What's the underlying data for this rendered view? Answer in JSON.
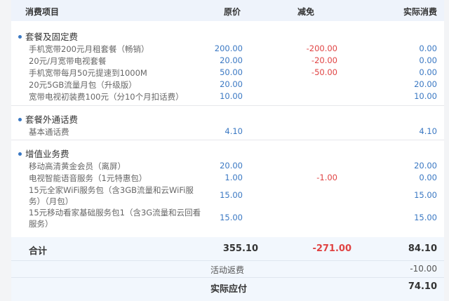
{
  "header": {
    "col_item": "消费项目",
    "col_original": "原价",
    "col_discount": "减免",
    "col_actual": "实际消费"
  },
  "sections": [
    {
      "title": "套餐及固定费",
      "rows": [
        {
          "name": "手机宽带200元月租套餐（畅销）",
          "original": "200.00",
          "discount": "-200.00",
          "actual": "0.00"
        },
        {
          "name": "20元/月宽带电视套餐",
          "original": "20.00",
          "discount": "-20.00",
          "actual": "0.00"
        },
        {
          "name": "手机宽带每月50元提速到1000M",
          "original": "50.00",
          "discount": "-50.00",
          "actual": "0.00"
        },
        {
          "name": "20元5GB流量月包（升级版）",
          "original": "20.00",
          "discount": "",
          "actual": "20.00"
        },
        {
          "name": "宽带电视初装费100元（分10个月扣话费）",
          "original": "10.00",
          "discount": "",
          "actual": "10.00"
        }
      ]
    },
    {
      "title": "套餐外通话费",
      "rows": [
        {
          "name": "基本通话费",
          "original": "4.10",
          "discount": "",
          "actual": "4.10"
        }
      ]
    },
    {
      "title": "增值业务费",
      "rows": [
        {
          "name": "移动高清黄金会员（离屏）",
          "original": "20.00",
          "discount": "",
          "actual": "20.00"
        },
        {
          "name": "电视智能语音服务（1元特惠包）",
          "original": "1.00",
          "discount": "-1.00",
          "actual": "0.00"
        },
        {
          "name": "15元全家WiFi服务包（含3GB流量和云WiFi服务）（月包）",
          "original": "15.00",
          "discount": "",
          "actual": "15.00"
        },
        {
          "name": "15元移动看家基础服务包1（含3G流量和云回看服务）",
          "original": "15.00",
          "discount": "",
          "actual": "15.00"
        }
      ]
    }
  ],
  "summary": {
    "total_label": "合计",
    "total_original": "355.10",
    "total_discount": "-271.00",
    "total_actual": "84.10",
    "rebate_label": "活动返费",
    "rebate_value": "-10.00",
    "payable_label": "实际应付",
    "payable_value": "74.10"
  },
  "colors": {
    "accent_blue": "#3a78c3",
    "discount_red": "#e04343",
    "header_bg": "#eef3fb",
    "summary_bg": "#f2f7fd"
  }
}
